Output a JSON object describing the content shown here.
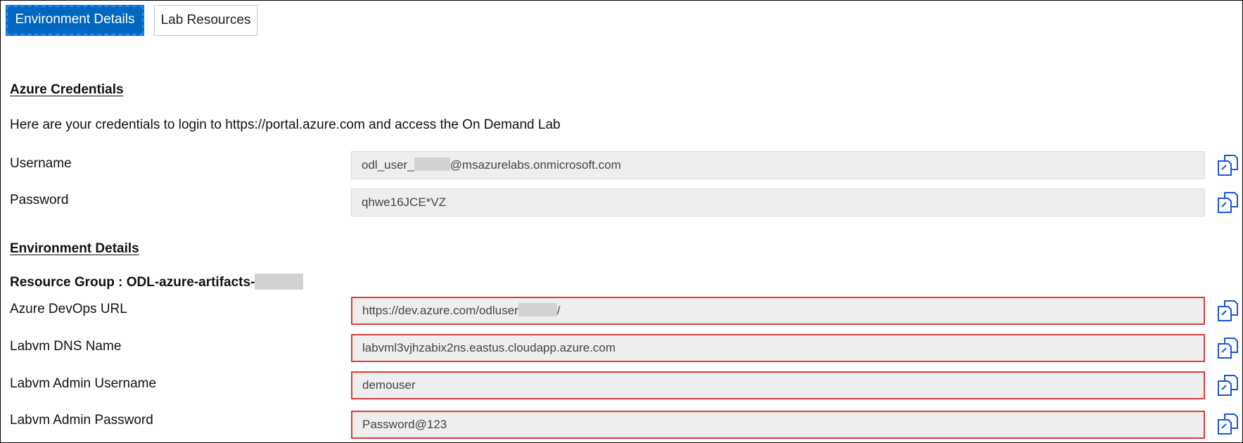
{
  "tabs": {
    "environment_details": "Environment Details",
    "lab_resources": "Lab Resources"
  },
  "azure_credentials": {
    "heading": "Azure Credentials",
    "intro": "Here are your credentials to login to https://portal.azure.com and access the On Demand Lab",
    "username_label": "Username",
    "username_prefix": "odl_user_",
    "username_suffix": "@msazurelabs.onmicrosoft.com",
    "password_label": "Password",
    "password_value": "qhwe16JCE*VZ"
  },
  "environment": {
    "heading": "Environment Details",
    "resource_group_label": "Resource Group : ODL-azure-artifacts-",
    "devops_label": "Azure DevOps URL",
    "devops_prefix": "https://dev.azure.com/odluser",
    "devops_suffix": "/",
    "dns_label": "Labvm DNS Name",
    "dns_value": "labvml3vjhzabix2ns.eastus.cloudapp.azure.com",
    "admin_user_label": "Labvm Admin Username",
    "admin_user_value": "demouser",
    "admin_pass_label": "Labvm Admin Password",
    "admin_pass_value": "Password@123"
  },
  "colors": {
    "accent": "#0067c0",
    "highlight_border": "#e03b3b",
    "copy_icon": "#1a56d6",
    "field_bg": "#eeeeee"
  },
  "icons": {
    "copy": "copy-icon"
  }
}
